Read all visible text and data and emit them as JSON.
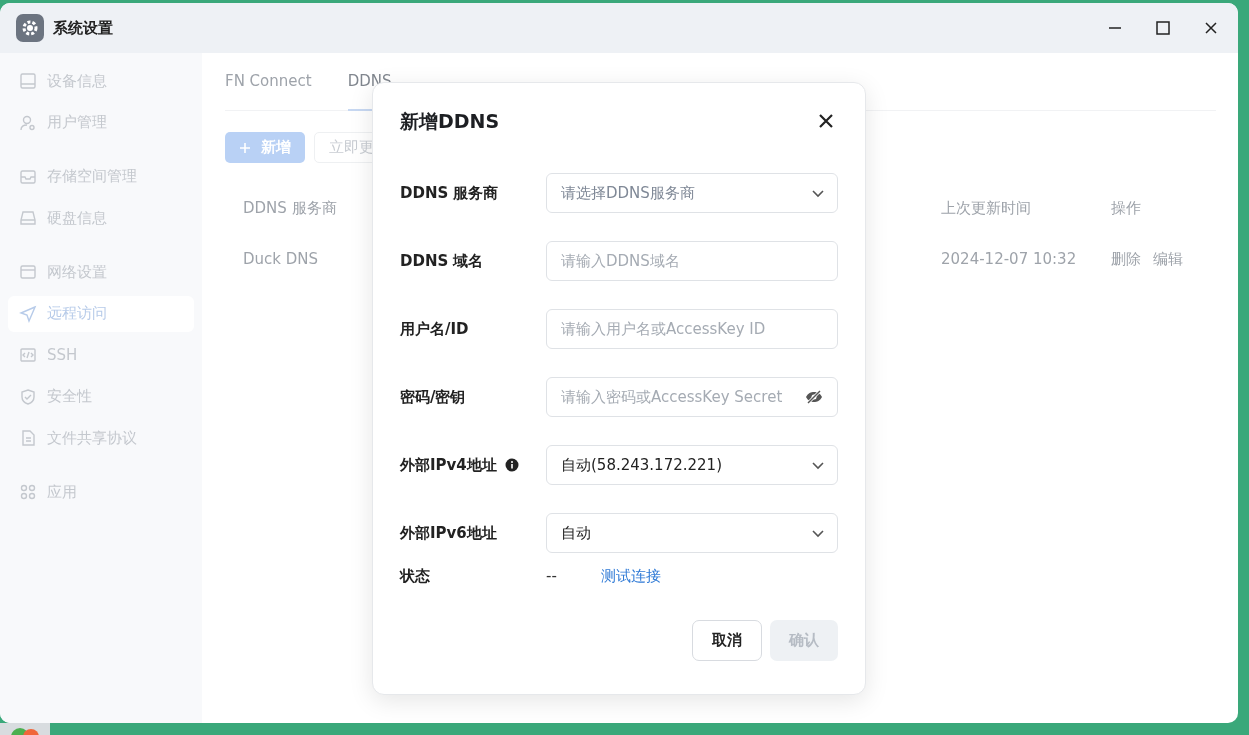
{
  "window": {
    "title": "系统设置"
  },
  "sidebar": {
    "groups": [
      {
        "items": [
          {
            "label": "设备信息",
            "selected": false
          },
          {
            "label": "用户管理",
            "selected": false
          }
        ]
      },
      {
        "items": [
          {
            "label": "存储空间管理",
            "selected": false
          },
          {
            "label": "硬盘信息",
            "selected": false
          }
        ]
      },
      {
        "items": [
          {
            "label": "网络设置",
            "selected": false
          },
          {
            "label": "远程访问",
            "selected": true
          },
          {
            "label": "SSH",
            "selected": false
          },
          {
            "label": "安全性",
            "selected": false
          },
          {
            "label": "文件共享协议",
            "selected": false
          }
        ]
      },
      {
        "items": [
          {
            "label": "应用",
            "selected": false
          }
        ]
      }
    ]
  },
  "tabs": [
    {
      "label": "FN Connect",
      "selected": false
    },
    {
      "label": "DDNS",
      "selected": true
    }
  ],
  "toolbar": {
    "add_button": "新增",
    "update_button": "立即更"
  },
  "table": {
    "columns": [
      "DDNS 服务商",
      "上次更新时间",
      "操作"
    ],
    "rows": [
      {
        "cells": [
          "Duck DNS",
          "2024-12-07 10:32"
        ],
        "actions": [
          "删除",
          "编辑"
        ]
      }
    ]
  },
  "dialog": {
    "title": "新增DDNS",
    "fields": [
      {
        "label": "DDNS 服务商",
        "kind": "select",
        "placeholder": "请选择DDNS服务商"
      },
      {
        "label": "DDNS 域名",
        "kind": "input",
        "placeholder": "请输入DDNS域名"
      },
      {
        "label": "用户名/ID",
        "kind": "input",
        "placeholder": "请输入用户名或AccessKey ID"
      },
      {
        "label": "密码/密钥",
        "kind": "password",
        "placeholder": "请输入密码或AccessKey Secret"
      },
      {
        "label": "外部IPv4地址",
        "kind": "select",
        "value": "自动(58.243.172.221)",
        "has_info": true
      },
      {
        "label": "外部IPv6地址",
        "kind": "select",
        "value": "自动"
      }
    ],
    "status": {
      "label": "状态",
      "value": "--",
      "link": "测试连接"
    },
    "buttons": [
      {
        "label": "取消",
        "disabled": false,
        "kind": "secondary"
      },
      {
        "label": "确认",
        "disabled": true,
        "kind": "primary"
      }
    ]
  }
}
